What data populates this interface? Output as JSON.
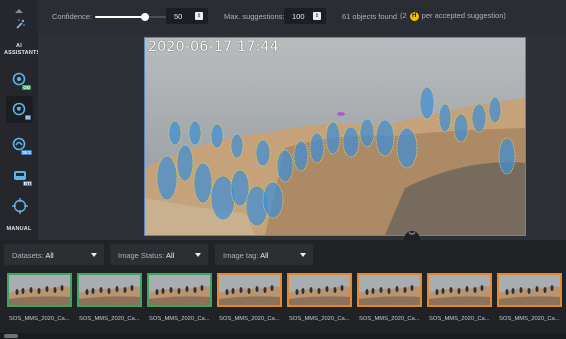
{
  "sidebar": {
    "section_label": "AI ASSISTANTS",
    "manual_label": "MANUAL",
    "badges": [
      "OD",
      "IS",
      "SES",
      "BTI"
    ],
    "icons": [
      "scroll-up-icon",
      "magic-wand-icon",
      "object-detection-icon",
      "instance-segmentation-icon",
      "semantic-segmentation-icon",
      "bti-icon",
      "crosshair-icon"
    ]
  },
  "toolbar": {
    "confidence_label": "Confidence:",
    "confidence_value": "50",
    "confidence_fraction": 0.5,
    "max_suggestions_label": "Max. suggestions:",
    "max_suggestions_value": "100",
    "objects_found_text": "61 objects found",
    "credit_prefix": "(2",
    "credit_icon_letter": "H",
    "credit_suffix": "per accepted suggestion)"
  },
  "image": {
    "timestamp": "2020-06-17 17:44"
  },
  "filters": {
    "datasets_label": "Datasets:",
    "datasets_value": "All",
    "image_status_label": "Image Status:",
    "image_status_value": "All",
    "image_tag_label": "Image tag:",
    "image_tag_value": "All"
  },
  "thumbnails": [
    {
      "name": "SOS_MMS_2020_Ca...",
      "status": "green"
    },
    {
      "name": "SOS_MMS_2020_Ca...",
      "status": "green"
    },
    {
      "name": "SOS_MMS_2020_Ca...",
      "status": "green"
    },
    {
      "name": "SOS_MMS_2020_Ca...",
      "status": "orange"
    },
    {
      "name": "SOS_MMS_2020_Ca...",
      "status": "orange"
    },
    {
      "name": "SOS_MMS_2020_Ca...",
      "status": "orange"
    },
    {
      "name": "SOS_MMS_2020_Ca...",
      "status": "orange"
    },
    {
      "name": "SOS_MMS_2020_Ca...",
      "status": "orange"
    }
  ],
  "colors": {
    "accepted": "#3aa660",
    "pending": "#e3892c",
    "selection": "#5a86c4",
    "credit": "#f2c200"
  }
}
